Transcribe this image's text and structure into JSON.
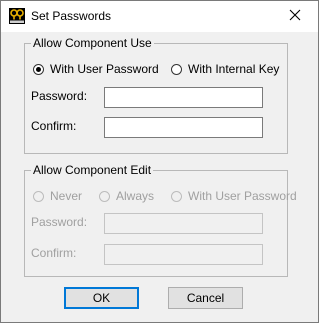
{
  "window": {
    "title": "Set Passwords",
    "icon": "key-app-icon",
    "close_icon": "close-icon"
  },
  "allow_use": {
    "label": "Allow Component Use",
    "options": [
      {
        "label": "With User Password",
        "checked": true
      },
      {
        "label": "With Internal Key",
        "checked": false
      }
    ],
    "password_label": "Password:",
    "password_value": "",
    "confirm_label": "Confirm:",
    "confirm_value": ""
  },
  "allow_edit": {
    "label": "Allow Component Edit",
    "enabled": false,
    "options": [
      {
        "label": "Never",
        "checked": false
      },
      {
        "label": "Always",
        "checked": false
      },
      {
        "label": "With User Password",
        "checked": false
      }
    ],
    "password_label": "Password:",
    "confirm_label": "Confirm:"
  },
  "buttons": {
    "ok": "OK",
    "cancel": "Cancel"
  },
  "colors": {
    "accent": "#0078d7",
    "window_bg": "#f0f0f0",
    "disabled_text": "#a0a0a0"
  }
}
